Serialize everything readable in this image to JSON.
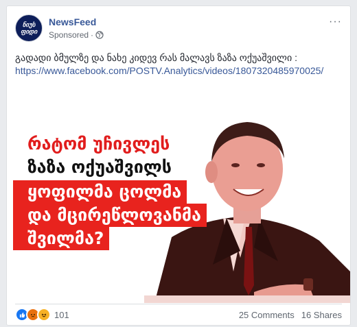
{
  "post": {
    "page_name": "NewsFeed",
    "sponsored_label": "Sponsored",
    "avatar_text_top": "ნიუს",
    "avatar_text_bottom": "ფიდი",
    "more_icon": "···",
    "text": "გადადი ბმულზე და ნახე კიდევ რას მალავს ზაზა ოქუაშვილი :",
    "link": "https://www.facebook.com/POSTV.Analytics/videos/1807320485970025/"
  },
  "media": {
    "headline_lines": [
      "რატომ უჩივლეს",
      "ზაზა ოქუაშვილს",
      "ყოფილმა ცოლმა",
      "და მცირეწლოვანმა",
      "შვილმა?"
    ]
  },
  "footer": {
    "reaction_count": "101",
    "comments": "25 Comments",
    "shares": "16 Shares",
    "reactions": [
      "like-icon",
      "angry-icon",
      "haha-icon"
    ]
  },
  "colors": {
    "link": "#385898",
    "headline_red": "#e8231e",
    "background": "#e9ebee"
  }
}
